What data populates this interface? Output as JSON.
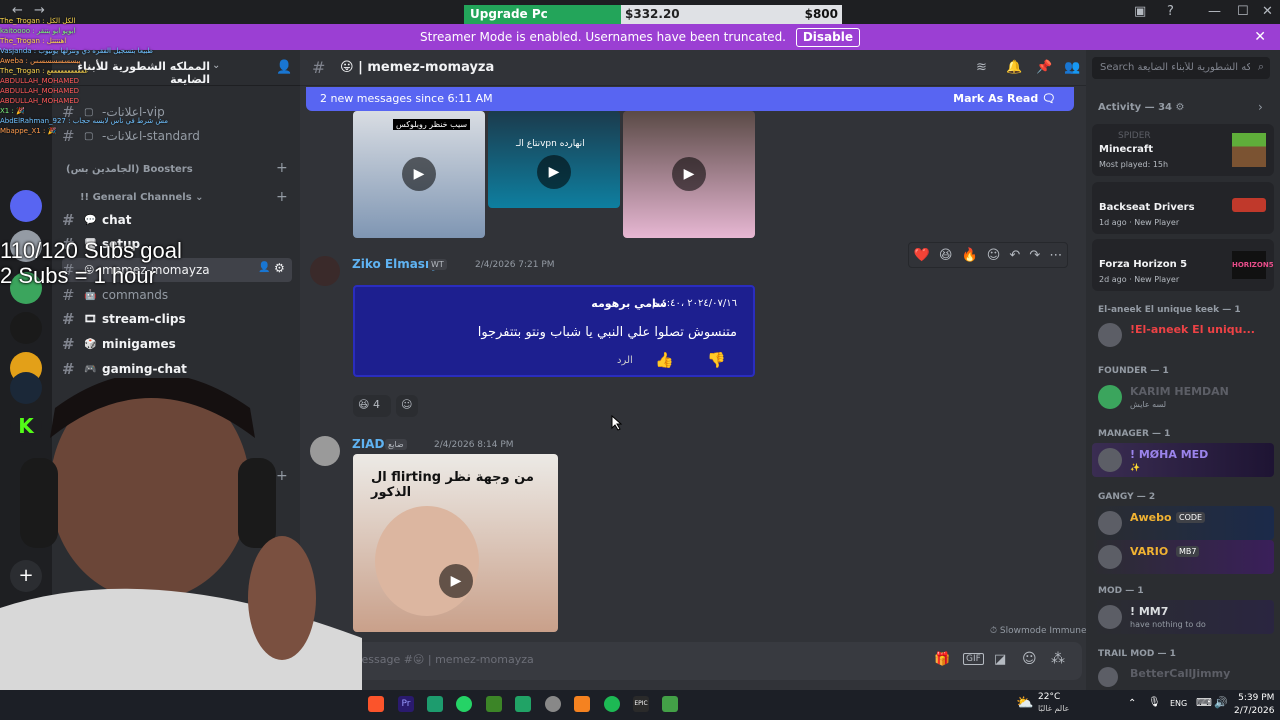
{
  "upgrade": {
    "label": "Upgrade Pc",
    "current": "$332.20",
    "goal": "$800",
    "progress": 0.415
  },
  "banner": {
    "text": "Streamer Mode is enabled. Usernames have been truncated.",
    "disable_label": "Disable"
  },
  "server": {
    "name": "المملكه الشطورية للأبناء الضايعة"
  },
  "sidebar": {
    "channels_top": [
      {
        "name": "-اعلانات-vip"
      },
      {
        "name": "-اعلانات-standard"
      }
    ],
    "boosters_label": "(الجامدين بس) Boosters",
    "general_category": "!! General Channels",
    "channels": [
      {
        "name": "chat"
      },
      {
        "name": "setup"
      },
      {
        "name": "memez-momayza"
      },
      {
        "name": "commands"
      },
      {
        "name": "stream-clips"
      },
      {
        "name": "minigames"
      },
      {
        "name": "gaming-chat"
      }
    ]
  },
  "header": {
    "channel_name": "memez-momayza",
    "search_placeholder": "Search المملكه الشطورية للأبناء الضايعة"
  },
  "new_messages": {
    "text": "2 new messages since 6:11 AM",
    "mark_read": "Mark As Read"
  },
  "messages": [
    {
      "author": "Ziko Elmasry",
      "badge": "WT",
      "timestamp": "2/4/2026 7:21 PM",
      "image_text": {
        "name": "سامي برهومه",
        "date": "٢٠٢٤/٠٧/١٦ ،٤:٤٠ م",
        "body": "متنسوش تصلوا علي النبي يا شباب ونتو بتتفرجوا",
        "reply": "الرد"
      },
      "reaction_count": "4"
    },
    {
      "author": "ZIAD",
      "badge": "ضايع",
      "timestamp": "2/4/2026 8:14 PM",
      "video_caption": "ال flirting من وجهة نظر الذكور"
    }
  ],
  "top_videos": [
    {
      "caption": "سيب خنظر روبلوكس"
    },
    {
      "caption": "نتاع الـvpn انهارده"
    },
    {
      "caption": ""
    }
  ],
  "composer": {
    "placeholder": "Message #😛 | memez-momayza",
    "slowmode": "Slowmode Immune"
  },
  "members": {
    "activity_header": "Activity — 34",
    "activities": [
      {
        "name": "SPIDER",
        "game": "Minecraft",
        "detail": "Most played: 15h"
      },
      {
        "name": "",
        "game": "Backseat Drivers",
        "detail": "1d ago · New Player"
      },
      {
        "name": "",
        "game": "Forza Horizon 5",
        "detail": "2d ago · New Player"
      }
    ],
    "groups": [
      {
        "role": "El-aneek El unique keek — 1",
        "members": [
          {
            "name": "!El-aneek El uniqu...",
            "status": "",
            "color": "#ed4245"
          }
        ]
      },
      {
        "role": "FOUNDER — 1",
        "members": [
          {
            "name": "KARIM HEMDAN",
            "status": "لسه عايش",
            "color": "#5c5e66"
          }
        ]
      },
      {
        "role": "MANAGER — 1",
        "members": [
          {
            "name": "! MØHA MED",
            "status": "✨",
            "color": "#9b84ec"
          }
        ]
      },
      {
        "role": "GANGY — 2",
        "members": [
          {
            "name": "Awebo",
            "status": "CODE",
            "color": "#f0b232"
          },
          {
            "name": "VARIO",
            "status": "MB7",
            "color": "#f0b232"
          }
        ]
      },
      {
        "role": "MOD — 1",
        "members": [
          {
            "name": "! MM7",
            "status": "have nothing to do",
            "color": "#dbdee1"
          }
        ]
      },
      {
        "role": "TRAIL MOD — 1",
        "members": [
          {
            "name": "BetterCallJimmy",
            "status": "",
            "color": "#5c5e66"
          }
        ]
      }
    ]
  },
  "overlay": {
    "subs_goal": "110/120 Subs goal",
    "subs_rule": "2 Subs = 1 hour"
  },
  "stream_chat": [
    "The_Trogan : الكل الكل",
    "kaitoooo : ابويو ابو بتنقر",
    "The_Trogan : اهتتتتل",
    "Vasjanda : طبيعا بتسجيل الفقره دي ونتزلها يوتيوب",
    "Aweba : يبسسسسسسس",
    "The_Trogan : عععععععععععع",
    "ABDULLAH_MOHAMED",
    "ABDULLAH_MOHAMED",
    "ABDULLAH_MOHAMED",
    "X1 : 🎉",
    "AbdElRahman_927 : مش شرط في ناس لابسه حجاب",
    "Mbappe_X1 : 🎉"
  ],
  "taskbar": {
    "weather_temp": "22°C",
    "weather_desc": "عالم غالبًا",
    "lang": "ENG",
    "time": "5:39 PM",
    "date": "2/7/2026"
  }
}
